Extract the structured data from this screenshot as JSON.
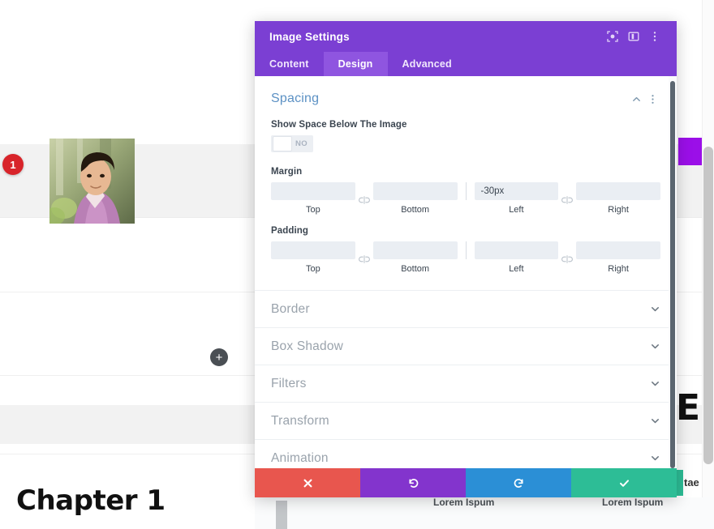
{
  "canvas": {
    "chapter_title": "Chapter 1",
    "heading_fragment": "E",
    "side_text_fragment": "tae",
    "add_module_glyph": "+",
    "photo_alt": "portrait-photo"
  },
  "modal": {
    "title": "Image Settings",
    "header_icons": [
      {
        "name": "focus-icon"
      },
      {
        "name": "layout-columns-icon"
      },
      {
        "name": "more-vertical-icon"
      }
    ],
    "tabs": [
      {
        "label": "Content",
        "active": false
      },
      {
        "label": "Design",
        "active": true
      },
      {
        "label": "Advanced",
        "active": false
      }
    ],
    "spacing": {
      "title": "Spacing",
      "collapse_icon": "chevron-up-icon",
      "options_icon": "more-vertical-icon",
      "toggle": {
        "label": "Show Space Below The Image",
        "state_text": "NO",
        "value": false
      },
      "margin": {
        "label": "Margin",
        "badge": "1",
        "fields": [
          {
            "caption": "Top",
            "value": "",
            "placeholder": ""
          },
          {
            "caption": "Bottom",
            "value": "",
            "placeholder": ""
          },
          {
            "caption": "Left",
            "value": "-30px",
            "placeholder": ""
          },
          {
            "caption": "Right",
            "value": "",
            "placeholder": ""
          }
        ],
        "link_icon": "broken-link-icon"
      },
      "padding": {
        "label": "Padding",
        "fields": [
          {
            "caption": "Top",
            "value": "",
            "placeholder": ""
          },
          {
            "caption": "Bottom",
            "value": "",
            "placeholder": ""
          },
          {
            "caption": "Left",
            "value": "",
            "placeholder": ""
          },
          {
            "caption": "Right",
            "value": "",
            "placeholder": ""
          }
        ],
        "link_icon": "broken-link-icon"
      }
    },
    "sections": [
      {
        "label": "Border",
        "icon": "chevron-down-icon"
      },
      {
        "label": "Box Shadow",
        "icon": "chevron-down-icon"
      },
      {
        "label": "Filters",
        "icon": "chevron-down-icon"
      },
      {
        "label": "Transform",
        "icon": "chevron-down-icon"
      },
      {
        "label": "Animation",
        "icon": "chevron-down-icon"
      }
    ],
    "footer": [
      {
        "name": "cancel-button",
        "icon": "close-icon",
        "color": "#e8564e"
      },
      {
        "name": "undo-button",
        "icon": "undo-icon",
        "color": "#8334cd"
      },
      {
        "name": "redo-button",
        "icon": "redo-icon",
        "color": "#2b8fd6"
      },
      {
        "name": "save-button",
        "icon": "check-icon",
        "color": "#2dbd96"
      }
    ]
  },
  "below_modal": {
    "label_left": "Lorem Ispum",
    "label_right": "Lorem Ispum"
  },
  "colors": {
    "header_purple": "#7b3fd3",
    "tab_active": "#8f55e0",
    "section_title": "#5c91c4",
    "badge_red": "#d8242a",
    "cancel": "#e8564e",
    "undo": "#8334cd",
    "redo": "#2b8fd6",
    "save": "#2dbd96",
    "accent_block": "#9b0fe8"
  }
}
